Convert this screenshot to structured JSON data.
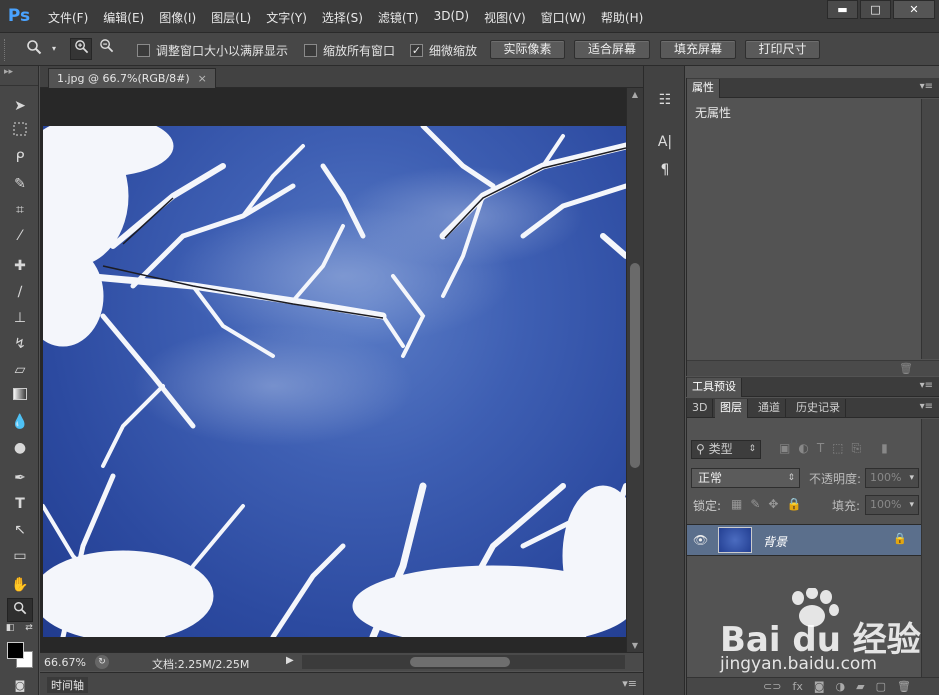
{
  "app": {
    "logo": "Ps"
  },
  "menu": [
    "文件(F)",
    "编辑(E)",
    "图像(I)",
    "图层(L)",
    "文字(Y)",
    "选择(S)",
    "滤镜(T)",
    "3D(D)",
    "视图(V)",
    "窗口(W)",
    "帮助(H)"
  ],
  "window_controls": {
    "minimize": "▬",
    "maximize": "□",
    "close": "✕"
  },
  "options": {
    "resize_windows": {
      "label": "调整窗口大小以满屏显示",
      "checked": false
    },
    "zoom_all": {
      "label": "缩放所有窗口",
      "checked": false
    },
    "scrubby_zoom": {
      "label": "细微缩放",
      "checked": true
    },
    "check_mark": "✓",
    "buttons": {
      "actual_pixels": "实际像素",
      "fit_screen": "适合屏幕",
      "fill_screen": "填充屏幕",
      "print_size": "打印尺寸"
    }
  },
  "document": {
    "tab_title": "1.jpg @ 66.7%(RGB/8#)",
    "tab_close": "×",
    "zoom": "66.67%",
    "doc_info": "文档:2.25M/2.25M"
  },
  "timeline": {
    "label": "时间轴"
  },
  "properties": {
    "tab": "属性",
    "body": "无属性"
  },
  "tool_presets": {
    "tab": "工具预设"
  },
  "layers_panel": {
    "tabs": [
      "3D",
      "图层",
      "通道",
      "历史记录"
    ],
    "active_tab": "图层",
    "filter_label": "类型",
    "blend_mode": "正常",
    "opacity_label": "不透明度:",
    "opacity_value": "100%",
    "lock_label": "锁定:",
    "fill_label": "填充:",
    "fill_value": "100%",
    "layer": {
      "name": "背景",
      "visible": true,
      "locked": true
    }
  },
  "watermark": {
    "brand": "Bai du 经验",
    "url": "jingyan.baidu.com"
  }
}
